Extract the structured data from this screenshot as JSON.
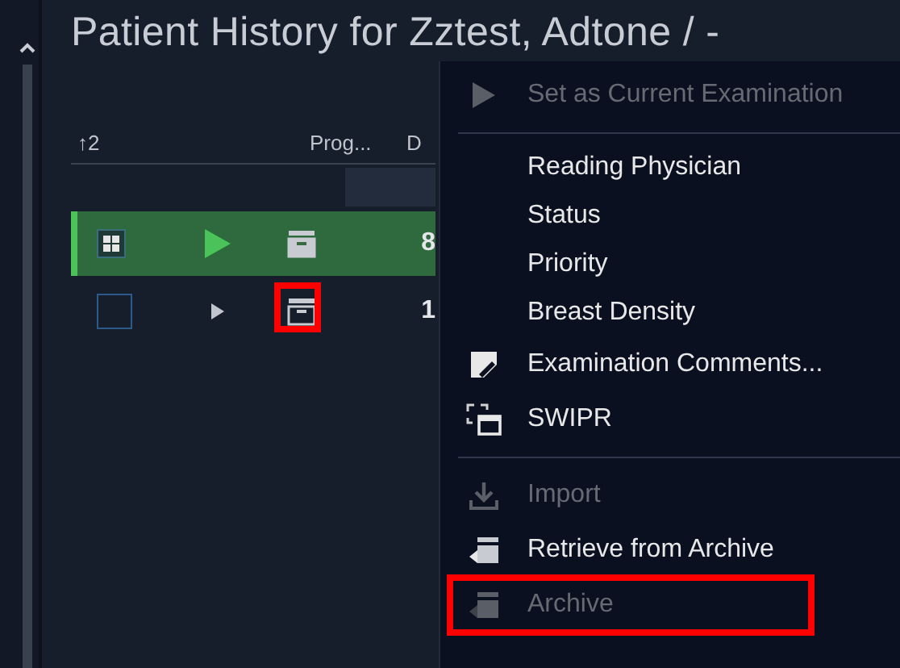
{
  "title": "Patient History for Zztest, Adtone / -",
  "table": {
    "columns": [
      "↑2",
      "Prog...",
      "D"
    ],
    "rows": [
      {
        "selected": true,
        "archive_highlighted": false,
        "column_3": "8"
      },
      {
        "selected": false,
        "archive_highlighted": true,
        "column_3": "1"
      }
    ]
  },
  "context_menu": [
    {
      "kind": "item",
      "label": "Set as Current Examination",
      "disabled": true,
      "highlighted": false
    },
    {
      "kind": "separator"
    },
    {
      "kind": "item",
      "label": "Reading Physician",
      "disabled": false,
      "highlighted": false
    },
    {
      "kind": "item",
      "label": "Status",
      "disabled": false,
      "highlighted": false
    },
    {
      "kind": "item",
      "label": "Priority",
      "disabled": false,
      "highlighted": false
    },
    {
      "kind": "item",
      "label": "Breast Density",
      "disabled": false,
      "highlighted": false
    },
    {
      "kind": "item",
      "label": "Examination Comments...",
      "disabled": false,
      "highlighted": false
    },
    {
      "kind": "item",
      "label": "SWIPR",
      "disabled": false,
      "highlighted": false
    },
    {
      "kind": "separator"
    },
    {
      "kind": "item",
      "label": "Import",
      "disabled": true,
      "highlighted": false
    },
    {
      "kind": "item",
      "label": "Retrieve from Archive",
      "disabled": false,
      "highlighted": false
    },
    {
      "kind": "item",
      "label": "Archive",
      "disabled": true,
      "highlighted": true
    }
  ]
}
